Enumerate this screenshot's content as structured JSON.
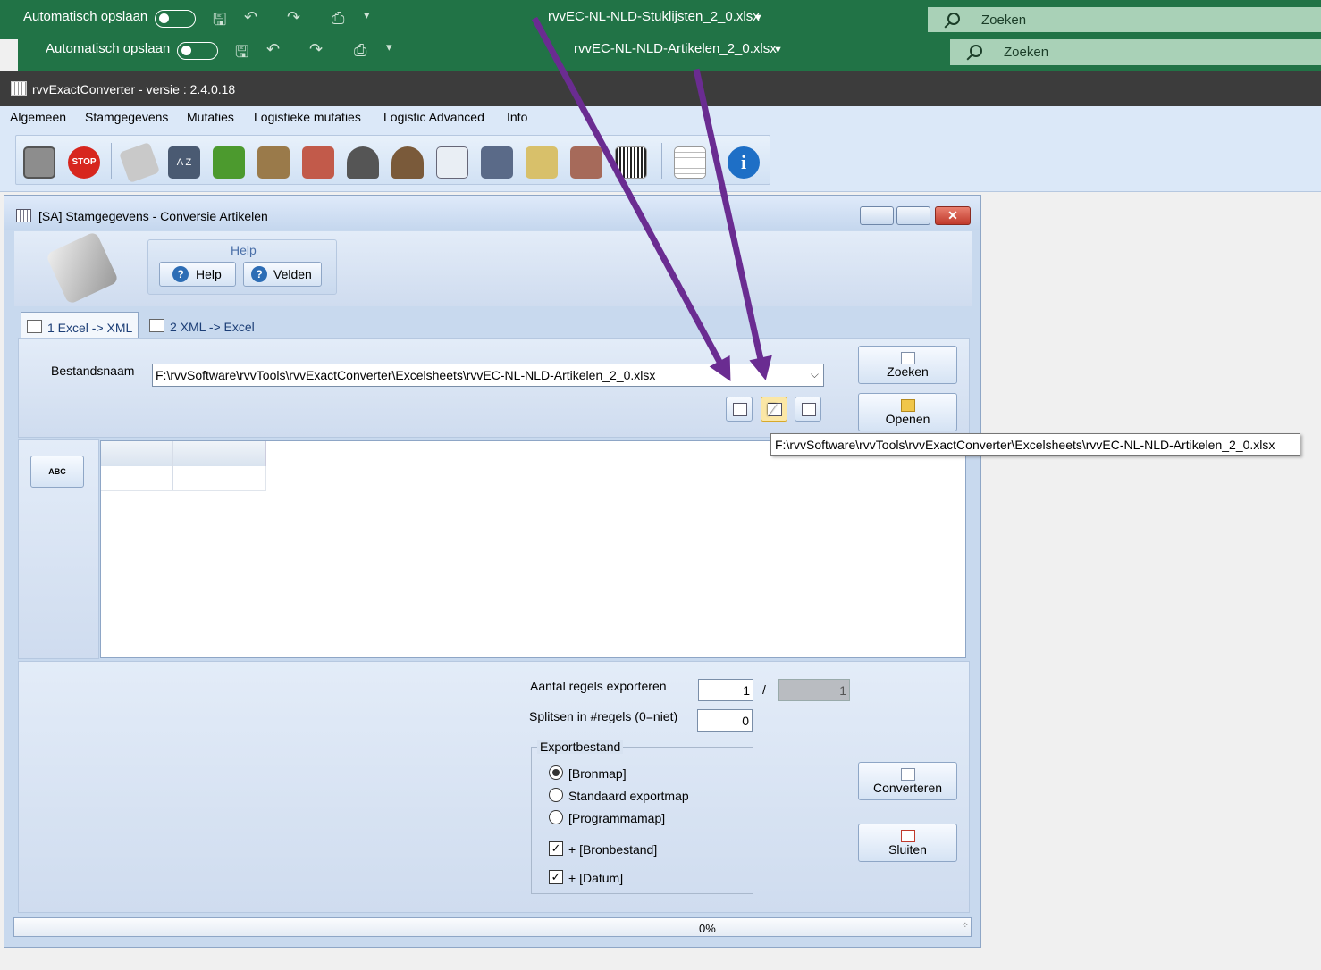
{
  "excel_back": {
    "autosave_label": "Automatisch opslaan",
    "filename": "rvvEC-NL-NLD-Stuklijsten_2_0.xlsx",
    "search": "Zoeken"
  },
  "excel_front": {
    "autosave_label": "Automatisch opslaan",
    "filename": "rvvEC-NL-NLD-Artikelen_2_0.xlsx",
    "search": "Zoeken"
  },
  "app": {
    "title": "rvvExactConverter - versie : 2.4.0.18"
  },
  "menu": [
    "Algemeen",
    "Stamgegevens",
    "Mutaties",
    "Logistieke mutaties",
    "Logistic Advanced",
    "Info"
  ],
  "toolbar_icons": [
    "dashboard-icon",
    "stop-icon",
    "document-icon",
    "a-z-book-icon",
    "truck-icon",
    "warehouse-icon",
    "factory-icon",
    "person-icon",
    "users-icon",
    "chart-icon",
    "document-stack-icon",
    "printer-icon",
    "building-icon",
    "barcode-icon",
    "notepad-icon",
    "info-icon"
  ],
  "dialog": {
    "title": "[SA]  Stamgegevens - Conversie Artikelen",
    "help_group": "Help",
    "help_btn": "Help",
    "fields_btn": "Velden",
    "tabs": [
      "1 Excel -> XML",
      "2 XML -> Excel"
    ],
    "file_label": "Bestandsnaam",
    "file_path": "F:\\rvvSoftware\\rvvTools\\rvvExactConverter\\Excelsheets\\rvvEC-NL-NLD-Artikelen_2_0.xlsx",
    "search_btn": "Zoeken",
    "open_btn": "Openen",
    "tooltip": "F:\\rvvSoftware\\rvvTools\\rvvExactConverter\\Excelsheets\\rvvEC-NL-NLD-Artikelen_2_0.xlsx",
    "abc_btn": "ABC",
    "export_rows_label": "Aantal regels exporteren",
    "export_rows_value": "1",
    "slash": "/",
    "export_rows_total": "1",
    "split_label": "Splitsen in #regels (0=niet)",
    "split_value": "0",
    "export_group": "Exportbestand",
    "opt_bronmap": "[Bronmap]",
    "opt_standaard": "Standaard exportmap",
    "opt_programma": "[Programmamap]",
    "chk_bronbestand": "+ [Bronbestand]",
    "chk_datum": "+ [Datum]",
    "convert_btn": "Converteren",
    "close_btn": "Sluiten",
    "progress": "0%"
  },
  "colors": {
    "excel_green": "#217346",
    "annotation_arrow": "#6a2c91"
  }
}
